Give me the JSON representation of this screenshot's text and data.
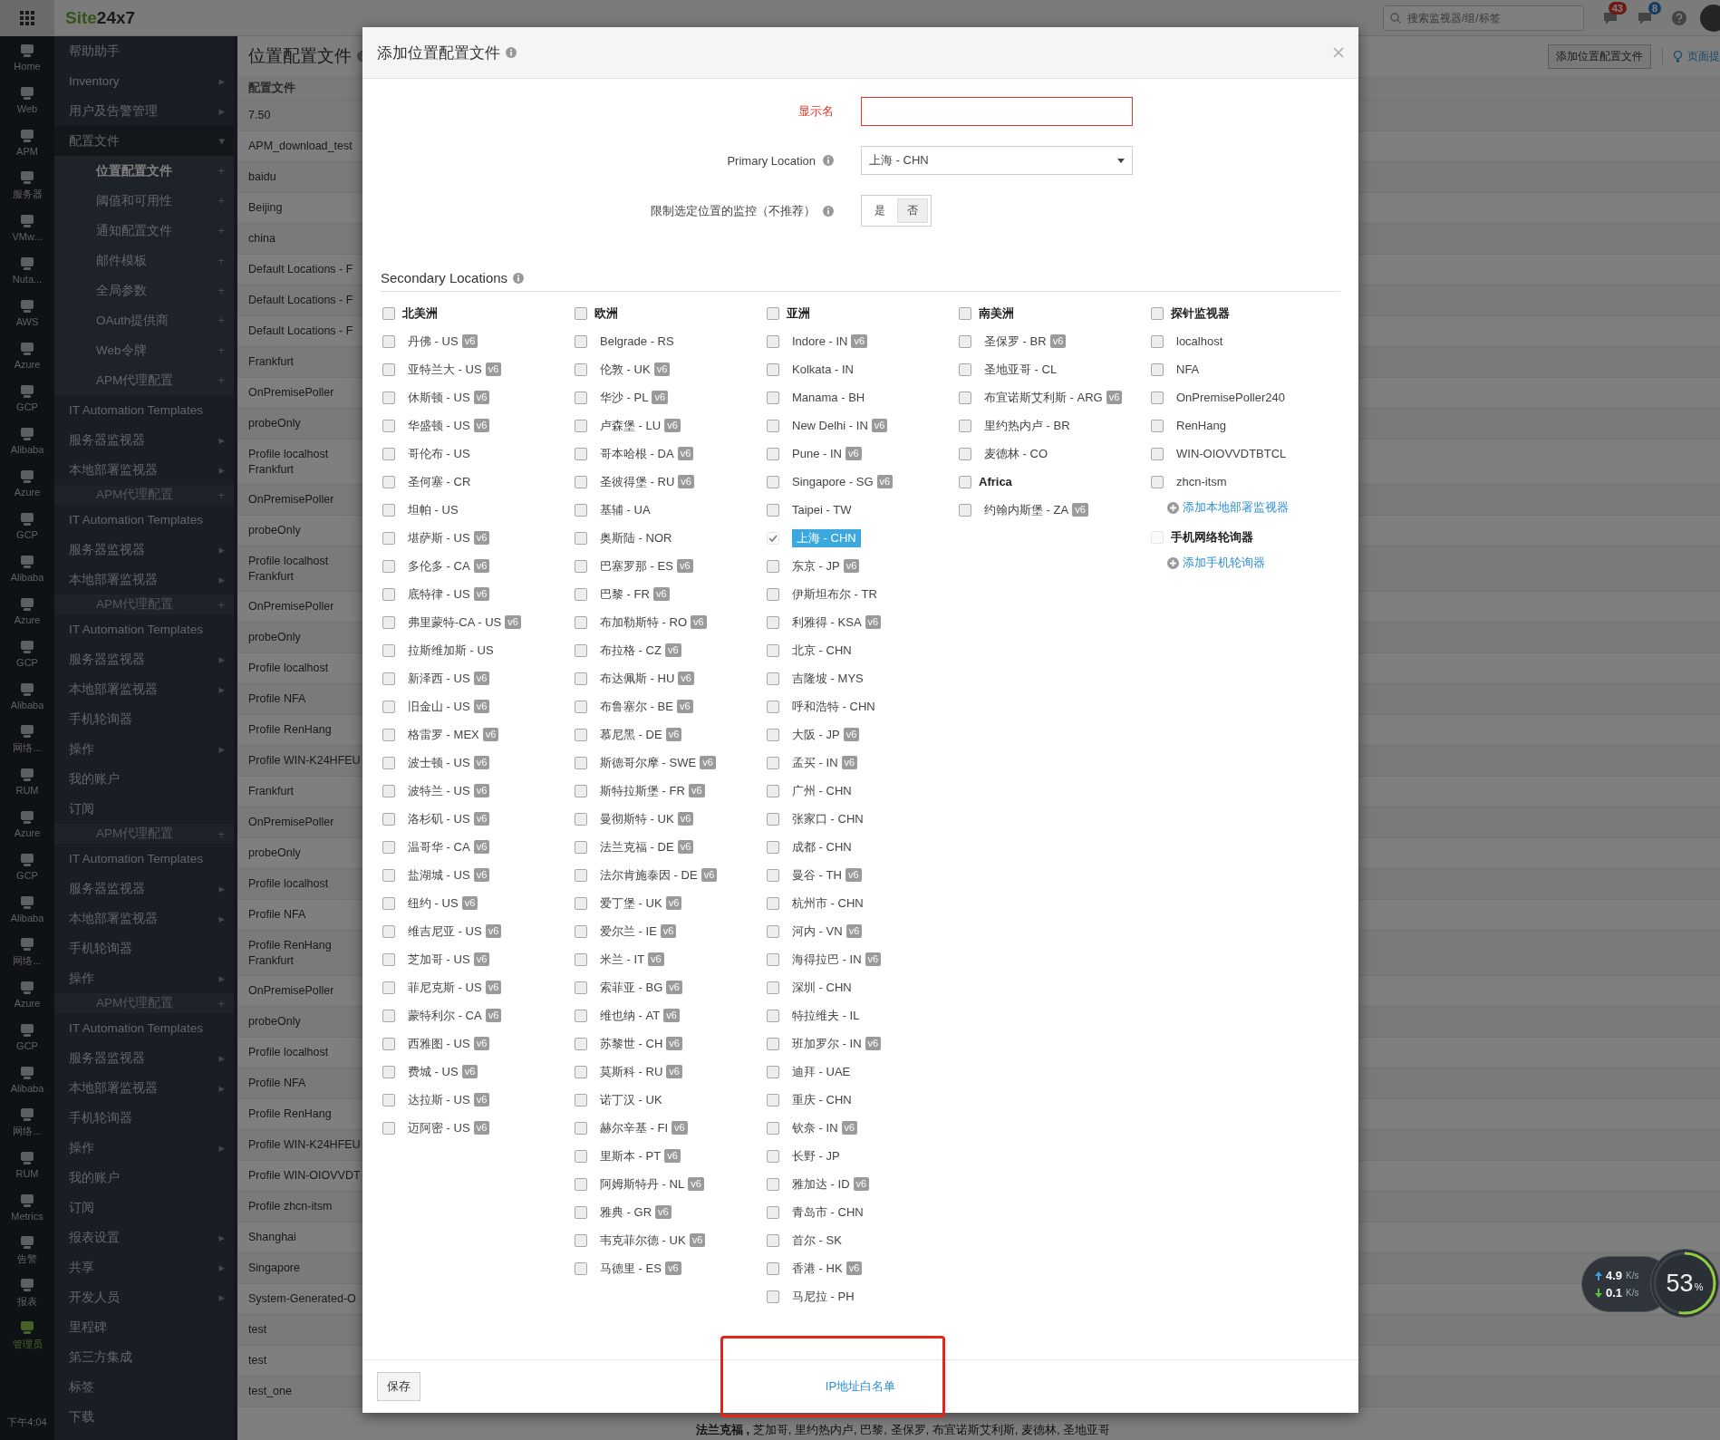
{
  "topbar": {
    "logo_site": "Site",
    "logo_suffix": "24x7",
    "search": {
      "placeholder": "搜索监视器/组/标签"
    },
    "alerts_count": "43",
    "messages_count": "8"
  },
  "rail": {
    "items": [
      {
        "label": "Home",
        "selected": false
      },
      {
        "label": "Web",
        "selected": false
      },
      {
        "label": "APM",
        "selected": false
      },
      {
        "label": "服务器",
        "selected": false
      },
      {
        "label": "VMw...",
        "selected": false
      },
      {
        "label": "Nuta...",
        "selected": false
      },
      {
        "label": "AWS",
        "selected": false
      },
      {
        "label": "Azure",
        "selected": false
      },
      {
        "label": "GCP",
        "selected": false
      },
      {
        "label": "Alibaba",
        "selected": false
      },
      {
        "label": "Azure",
        "selected": false
      },
      {
        "label": "GCP",
        "selected": false
      },
      {
        "label": "Alibaba",
        "selected": false
      },
      {
        "label": "Azure",
        "selected": false
      },
      {
        "label": "GCP",
        "selected": false
      },
      {
        "label": "Alibaba",
        "selected": false
      },
      {
        "label": "网络...",
        "selected": false
      },
      {
        "label": "RUM",
        "selected": false
      },
      {
        "label": "Azure",
        "selected": false
      },
      {
        "label": "GCP",
        "selected": false
      },
      {
        "label": "Alibaba",
        "selected": false
      },
      {
        "label": "网络...",
        "selected": false
      },
      {
        "label": "Azure",
        "selected": false
      },
      {
        "label": "GCP",
        "selected": false
      },
      {
        "label": "Alibaba",
        "selected": false
      },
      {
        "label": "网络...",
        "selected": false
      },
      {
        "label": "RUM",
        "selected": false
      },
      {
        "label": "Metrics",
        "selected": false
      },
      {
        "label": "告警",
        "selected": false
      },
      {
        "label": "报表",
        "selected": false
      },
      {
        "label": "管理员",
        "selected": true
      }
    ],
    "clock": "下午4:04"
  },
  "sidebar": {
    "items": [
      {
        "label": "帮助助手",
        "kind": "main",
        "selected": false
      },
      {
        "label": "Inventory",
        "kind": "main",
        "indicator": "▸",
        "selected": false
      },
      {
        "label": "用户及告警管理",
        "kind": "main",
        "indicator": "▸",
        "selected": false
      },
      {
        "label": "配置文件",
        "kind": "open",
        "indicator": "▾",
        "selected": false
      },
      {
        "label": "位置配置文件",
        "kind": "sub",
        "indicator": "+",
        "selected": true
      },
      {
        "label": "阈值和可用性",
        "kind": "sub",
        "indicator": "+",
        "selected": false
      },
      {
        "label": "通知配置文件",
        "kind": "sub",
        "indicator": "+",
        "selected": false
      },
      {
        "label": "邮件模板",
        "kind": "sub",
        "indicator": "+",
        "selected": false
      },
      {
        "label": "全局参数",
        "kind": "sub",
        "indicator": "+",
        "selected": false
      },
      {
        "label": "OAuth提供商",
        "kind": "sub",
        "indicator": "+",
        "selected": false
      },
      {
        "label": "Web令牌",
        "kind": "sub",
        "indicator": "+",
        "selected": false
      },
      {
        "label": "APM代理配置",
        "kind": "sub",
        "indicator": "+",
        "selected": false
      },
      {
        "label": "IT Automation Templates",
        "kind": "main",
        "selected": false
      },
      {
        "label": "服务器监视器",
        "kind": "main",
        "indicator": "▸",
        "selected": false
      },
      {
        "label": "本地部署监视器",
        "kind": "main",
        "indicator": "▸",
        "selected": false
      },
      {
        "label": "APM代理配置",
        "kind": "ghost",
        "indicator": "+",
        "selected": false
      },
      {
        "label": "IT Automation Templates",
        "kind": "main",
        "selected": false
      },
      {
        "label": "服务器监视器",
        "kind": "main",
        "indicator": "▸",
        "selected": false
      },
      {
        "label": "本地部署监视器",
        "kind": "main",
        "indicator": "▸",
        "selected": false
      },
      {
        "label": "APM代理配置",
        "kind": "ghost",
        "indicator": "+",
        "selected": false
      },
      {
        "label": "IT Automation Templates",
        "kind": "main",
        "selected": false
      },
      {
        "label": "服务器监视器",
        "kind": "main",
        "indicator": "▸",
        "selected": false
      },
      {
        "label": "本地部署监视器",
        "kind": "main",
        "indicator": "▸",
        "selected": false
      },
      {
        "label": "手机轮询器",
        "kind": "main",
        "selected": false
      },
      {
        "label": "操作",
        "kind": "main",
        "indicator": "▸",
        "selected": false
      },
      {
        "label": "我的账户",
        "kind": "main",
        "selected": false
      },
      {
        "label": "订阅",
        "kind": "main",
        "selected": false
      },
      {
        "label": "APM代理配置",
        "kind": "ghost",
        "indicator": "+",
        "selected": false
      },
      {
        "label": "IT Automation Templates",
        "kind": "main",
        "selected": false
      },
      {
        "label": "服务器监视器",
        "kind": "main",
        "indicator": "▸",
        "selected": false
      },
      {
        "label": "本地部署监视器",
        "kind": "main",
        "indicator": "▸",
        "selected": false
      },
      {
        "label": "手机轮询器",
        "kind": "main",
        "selected": false
      },
      {
        "label": "操作",
        "kind": "main",
        "indicator": "▸",
        "selected": false
      },
      {
        "label": "APM代理配置",
        "kind": "ghost",
        "indicator": "+",
        "selected": false
      },
      {
        "label": "IT Automation Templates",
        "kind": "main",
        "selected": false
      },
      {
        "label": "服务器监视器",
        "kind": "main",
        "indicator": "▸",
        "selected": false
      },
      {
        "label": "本地部署监视器",
        "kind": "main",
        "indicator": "▸",
        "selected": false
      },
      {
        "label": "手机轮询器",
        "kind": "main",
        "selected": false
      },
      {
        "label": "操作",
        "kind": "main",
        "indicator": "▸",
        "selected": false
      },
      {
        "label": "我的账户",
        "kind": "main",
        "selected": false
      },
      {
        "label": "订阅",
        "kind": "main",
        "selected": false
      },
      {
        "label": "报表设置",
        "kind": "main",
        "indicator": "▸",
        "selected": false
      },
      {
        "label": "共享",
        "kind": "main",
        "indicator": "▸",
        "selected": false
      },
      {
        "label": "开发人员",
        "kind": "main",
        "indicator": "▸",
        "selected": false
      },
      {
        "label": "里程碑",
        "kind": "main",
        "selected": false
      },
      {
        "label": "第三方集成",
        "kind": "main",
        "selected": false
      },
      {
        "label": "标签",
        "kind": "main",
        "selected": false
      },
      {
        "label": "下载",
        "kind": "main",
        "selected": false
      }
    ]
  },
  "page": {
    "title": "位置配置文件",
    "add_button": "添加位置配置文件",
    "tips_link": "页面提",
    "table": {
      "column": "配置文件",
      "rows": [
        "7.50",
        "APM_download_test",
        "baidu",
        "Beijing",
        "china",
        "Default Locations - F",
        "Default Locations - F",
        "Default Locations - F",
        "Frankfurt",
        "OnPremisePoller",
        "probeOnly",
        "Profile localhost\nFrankfurt",
        "OnPremisePoller",
        "probeOnly",
        "Profile localhost\nFrankfurt",
        "OnPremisePoller",
        "probeOnly",
        "Profile localhost",
        "Profile NFA",
        "Profile RenHang",
        "Profile WIN-K24HFEU",
        "Frankfurt",
        "OnPremisePoller",
        "probeOnly",
        "Profile localhost",
        "Profile NFA",
        "Profile RenHang\nFrankfurt",
        "OnPremisePoller",
        "probeOnly",
        "Profile localhost",
        "Profile NFA",
        "Profile RenHang",
        "Profile WIN-K24HFEU",
        "Profile WIN-OIOVVDT",
        "Profile zhcn-itsm",
        "Shanghai",
        "Singapore",
        "System-Generated-O",
        "test",
        "test",
        "test_one"
      ]
    },
    "footnote": "**法兰克福 ,** 芝加哥, 里约热内卢, 巴黎, 圣保罗, 布宜诺斯艾利斯, 麦德林, 圣地亚哥"
  },
  "modal": {
    "title": "添加位置配置文件",
    "display_name": {
      "label": "显示名",
      "invalid": true
    },
    "primary_location": {
      "label": "Primary Location",
      "value": "上海 - CHN"
    },
    "restrict": {
      "label": "限制选定位置的监控（不推荐）",
      "options": [
        {
          "label": "是",
          "selected": false
        },
        {
          "label": "否",
          "selected": true
        }
      ]
    },
    "secondary_title": "Secondary Locations",
    "columns": [
      {
        "groups": [
          {
            "title": "北美洲",
            "checked": false,
            "disabled": false,
            "items": [
              {
                "label": "丹佛 - US",
                "badge": "v6",
                "checked": false,
                "highlighted": false
              },
              {
                "label": "亚特兰大 - US",
                "badge": "v6",
                "checked": false,
                "highlighted": false
              },
              {
                "label": "休斯顿 - US",
                "badge": "v6",
                "checked": false,
                "highlighted": false
              },
              {
                "label": "华盛顿 - US",
                "badge": "v6",
                "checked": false,
                "highlighted": false
              },
              {
                "label": "哥伦布 - US",
                "checked": false,
                "highlighted": false
              },
              {
                "label": "圣何塞 - CR",
                "checked": false,
                "highlighted": false
              },
              {
                "label": "坦帕 - US",
                "checked": false,
                "highlighted": false
              },
              {
                "label": "堪萨斯 - US",
                "badge": "v6",
                "checked": false,
                "highlighted": false
              },
              {
                "label": "多伦多 - CA",
                "badge": "v6",
                "checked": false,
                "highlighted": false
              },
              {
                "label": "底特律 - US",
                "badge": "v6",
                "checked": false,
                "highlighted": false
              },
              {
                "label": "弗里蒙特-CA - US",
                "badge": "v6",
                "checked": false,
                "highlighted": false
              },
              {
                "label": "拉斯维加斯 - US",
                "checked": false,
                "highlighted": false
              },
              {
                "label": "新泽西 - US",
                "badge": "v6",
                "checked": false,
                "highlighted": false
              },
              {
                "label": "旧金山 - US",
                "badge": "v6",
                "checked": false,
                "highlighted": false
              },
              {
                "label": "格雷罗 - MEX",
                "badge": "v6",
                "checked": false,
                "highlighted": false
              },
              {
                "label": "波士顿 - US",
                "badge": "v6",
                "checked": false,
                "highlighted": false
              },
              {
                "label": "波特兰 - US",
                "badge": "v6",
                "checked": false,
                "highlighted": false
              },
              {
                "label": "洛杉矶 - US",
                "badge": "v6",
                "checked": false,
                "highlighted": false
              },
              {
                "label": "温哥华 - CA",
                "badge": "v6",
                "checked": false,
                "highlighted": false
              },
              {
                "label": "盐湖城 - US",
                "badge": "v6",
                "checked": false,
                "highlighted": false
              },
              {
                "label": "纽约 - US",
                "badge": "v6",
                "checked": false,
                "highlighted": false
              },
              {
                "label": "维吉尼亚 - US",
                "badge": "v6",
                "checked": false,
                "highlighted": false
              },
              {
                "label": "芝加哥 - US",
                "badge": "v6",
                "checked": false,
                "highlighted": false
              },
              {
                "label": "菲尼克斯 - US",
                "badge": "v6",
                "checked": false,
                "highlighted": false
              },
              {
                "label": "蒙特利尔 - CA",
                "badge": "v6",
                "checked": false,
                "highlighted": false
              },
              {
                "label": "西雅图 - US",
                "badge": "v6",
                "checked": false,
                "highlighted": false
              },
              {
                "label": "费城 - US",
                "badge": "v6",
                "checked": false,
                "highlighted": false
              },
              {
                "label": "达拉斯 - US",
                "badge": "v6",
                "checked": false,
                "highlighted": false
              },
              {
                "label": "迈阿密 - US",
                "badge": "v6",
                "checked": false,
                "highlighted": false
              }
            ]
          }
        ]
      },
      {
        "groups": [
          {
            "title": "欧洲",
            "checked": false,
            "disabled": false,
            "items": [
              {
                "label": "Belgrade - RS",
                "checked": false,
                "highlighted": false
              },
              {
                "label": "伦敦 - UK",
                "badge": "v6",
                "checked": false,
                "highlighted": false
              },
              {
                "label": "华沙 - PL",
                "badge": "v6",
                "checked": false,
                "highlighted": false
              },
              {
                "label": "卢森堡 - LU",
                "badge": "v6",
                "checked": false,
                "highlighted": false
              },
              {
                "label": "哥本哈根 - DA",
                "badge": "v6",
                "checked": false,
                "highlighted": false
              },
              {
                "label": "圣彼得堡 - RU",
                "badge": "v6",
                "checked": false,
                "highlighted": false
              },
              {
                "label": "基辅 - UA",
                "checked": false,
                "highlighted": false
              },
              {
                "label": "奥斯陆 - NOR",
                "checked": false,
                "highlighted": false
              },
              {
                "label": "巴塞罗那 - ES",
                "badge": "v6",
                "checked": false,
                "highlighted": false
              },
              {
                "label": "巴黎 - FR",
                "badge": "v6",
                "checked": false,
                "highlighted": false
              },
              {
                "label": "布加勒斯特 - RO",
                "badge": "v6",
                "checked": false,
                "highlighted": false
              },
              {
                "label": "布拉格 - CZ",
                "badge": "v6",
                "checked": false,
                "highlighted": false
              },
              {
                "label": "布达佩斯 - HU",
                "badge": "v6",
                "checked": false,
                "highlighted": false
              },
              {
                "label": "布鲁塞尔 - BE",
                "badge": "v6",
                "checked": false,
                "highlighted": false
              },
              {
                "label": "慕尼黑 - DE",
                "badge": "v6",
                "checked": false,
                "highlighted": false
              },
              {
                "label": "斯德哥尔摩 - SWE",
                "badge": "v6",
                "checked": false,
                "highlighted": false
              },
              {
                "label": "斯特拉斯堡 - FR",
                "badge": "v6",
                "checked": false,
                "highlighted": false
              },
              {
                "label": "曼彻斯特 - UK",
                "badge": "v6",
                "checked": false,
                "highlighted": false
              },
              {
                "label": "法兰克福 - DE",
                "badge": "v6",
                "checked": false,
                "highlighted": false
              },
              {
                "label": "法尔肯施泰因 - DE",
                "badge": "v6",
                "checked": false,
                "highlighted": false
              },
              {
                "label": "爱丁堡 - UK",
                "badge": "v6",
                "checked": false,
                "highlighted": false
              },
              {
                "label": "爱尔兰 - IE",
                "badge": "v6",
                "checked": false,
                "highlighted": false
              },
              {
                "label": "米兰 - IT",
                "badge": "v6",
                "checked": false,
                "highlighted": false
              },
              {
                "label": "索菲亚 - BG",
                "badge": "v6",
                "checked": false,
                "highlighted": false
              },
              {
                "label": "维也纳 - AT",
                "badge": "v6",
                "checked": false,
                "highlighted": false
              },
              {
                "label": "苏黎世 - CH",
                "badge": "v6",
                "checked": false,
                "highlighted": false
              },
              {
                "label": "莫斯科 - RU",
                "badge": "v6",
                "checked": false,
                "highlighted": false
              },
              {
                "label": "诺丁汉 - UK",
                "checked": false,
                "highlighted": false
              },
              {
                "label": "赫尔辛基 - FI",
                "badge": "v6",
                "checked": false,
                "highlighted": false
              },
              {
                "label": "里斯本 - PT",
                "badge": "v6",
                "checked": false,
                "highlighted": false
              },
              {
                "label": "阿姆斯特丹 - NL",
                "badge": "v6",
                "checked": false,
                "highlighted": false
              },
              {
                "label": "雅典 - GR",
                "badge": "v6",
                "checked": false,
                "highlighted": false
              },
              {
                "label": "韦克菲尔德 - UK",
                "badge": "v6",
                "checked": false,
                "highlighted": false
              },
              {
                "label": "马德里 - ES",
                "badge": "v6",
                "checked": false,
                "highlighted": false
              }
            ]
          }
        ]
      },
      {
        "groups": [
          {
            "title": "亚洲",
            "checked": false,
            "disabled": false,
            "items": [
              {
                "label": "Indore - IN",
                "badge": "v6",
                "checked": false,
                "highlighted": false
              },
              {
                "label": "Kolkata - IN",
                "checked": false,
                "highlighted": false
              },
              {
                "label": "Manama - BH",
                "checked": false,
                "highlighted": false
              },
              {
                "label": "New Delhi - IN",
                "badge": "v6",
                "checked": false,
                "highlighted": false
              },
              {
                "label": "Pune - IN",
                "badge": "v6",
                "checked": false,
                "highlighted": false
              },
              {
                "label": "Singapore - SG",
                "badge": "v6",
                "checked": false,
                "highlighted": false
              },
              {
                "label": "Taipei - TW",
                "checked": false,
                "highlighted": false
              },
              {
                "label": "上海 - CHN",
                "checked": true,
                "highlighted": true
              },
              {
                "label": "东京 - JP",
                "badge": "v6",
                "checked": false,
                "highlighted": false
              },
              {
                "label": "伊斯坦布尔 - TR",
                "checked": false,
                "highlighted": false
              },
              {
                "label": "利雅得 - KSA",
                "badge": "v6",
                "checked": false,
                "highlighted": false
              },
              {
                "label": "北京 - CHN",
                "checked": false,
                "highlighted": false
              },
              {
                "label": "吉隆坡 - MYS",
                "checked": false,
                "highlighted": false
              },
              {
                "label": "呼和浩特 - CHN",
                "checked": false,
                "highlighted": false
              },
              {
                "label": "大阪 - JP",
                "badge": "v6",
                "checked": false,
                "highlighted": false
              },
              {
                "label": "孟买 - IN",
                "badge": "v6",
                "checked": false,
                "highlighted": false
              },
              {
                "label": "广州 - CHN",
                "checked": false,
                "highlighted": false
              },
              {
                "label": "张家口 - CHN",
                "checked": false,
                "highlighted": false
              },
              {
                "label": "成都 - CHN",
                "checked": false,
                "highlighted": false
              },
              {
                "label": "曼谷 - TH",
                "badge": "v6",
                "checked": false,
                "highlighted": false
              },
              {
                "label": "杭州市 - CHN",
                "checked": false,
                "highlighted": false
              },
              {
                "label": "河内 - VN",
                "badge": "v6",
                "checked": false,
                "highlighted": false
              },
              {
                "label": "海得拉巴 - IN",
                "badge": "v6",
                "checked": false,
                "highlighted": false
              },
              {
                "label": "深圳 - CHN",
                "checked": false,
                "highlighted": false
              },
              {
                "label": "特拉维夫 - IL",
                "checked": false,
                "highlighted": false
              },
              {
                "label": "班加罗尔 - IN",
                "badge": "v6",
                "checked": false,
                "highlighted": false
              },
              {
                "label": "迪拜 - UAE",
                "checked": false,
                "highlighted": false
              },
              {
                "label": "重庆 - CHN",
                "checked": false,
                "highlighted": false
              },
              {
                "label": "钦奈 - IN",
                "badge": "v6",
                "checked": false,
                "highlighted": false
              },
              {
                "label": "长野 - JP",
                "checked": false,
                "highlighted": false
              },
              {
                "label": "雅加达 - ID",
                "badge": "v6",
                "checked": false,
                "highlighted": false
              },
              {
                "label": "青岛市 - CHN",
                "checked": false,
                "highlighted": false
              },
              {
                "label": "首尔 - SK",
                "checked": false,
                "highlighted": false
              },
              {
                "label": "香港 - HK",
                "badge": "v6",
                "checked": false,
                "highlighted": false
              },
              {
                "label": "马尼拉 - PH",
                "checked": false,
                "highlighted": false
              }
            ]
          }
        ]
      },
      {
        "groups": [
          {
            "title": "南美洲",
            "checked": false,
            "disabled": false,
            "items": [
              {
                "label": "圣保罗 - BR",
                "badge": "v6",
                "checked": false,
                "highlighted": false
              },
              {
                "label": "圣地亚哥 - CL",
                "checked": false,
                "highlighted": false
              },
              {
                "label": "布宜诺斯艾利斯 - ARG",
                "badge": "v6",
                "checked": false,
                "highlighted": false
              },
              {
                "label": "里约热内卢 - BR",
                "checked": false,
                "highlighted": false
              },
              {
                "label": "麦德林 - CO",
                "checked": false,
                "highlighted": false
              }
            ]
          },
          {
            "title": "Africa",
            "checked": false,
            "disabled": false,
            "items": [
              {
                "label": "约翰内斯堡 - ZA",
                "badge": "v6",
                "checked": false,
                "highlighted": false
              }
            ]
          }
        ]
      },
      {
        "groups": [
          {
            "title": "探针监视器",
            "checked": false,
            "disabled": false,
            "items": [
              {
                "label": "localhost",
                "checked": false,
                "highlighted": false
              },
              {
                "label": "NFA",
                "checked": false,
                "highlighted": false
              },
              {
                "label": "OnPremisePoller240",
                "checked": false,
                "highlighted": false
              },
              {
                "label": "RenHang",
                "checked": false,
                "highlighted": false
              },
              {
                "label": "WIN-OIOVVDTBTCL",
                "checked": false,
                "highlighted": false
              },
              {
                "label": "zhcn-itsm",
                "checked": false,
                "highlighted": false
              }
            ],
            "add_link": "添加本地部署监视器"
          },
          {
            "title": "手机网络轮询器",
            "checked": false,
            "disabled": true,
            "add_link": "添加手机轮询器"
          }
        ]
      }
    ],
    "save_button": "保存",
    "whitelist_link": "IP地址白名单"
  },
  "speed": {
    "up": "4.9",
    "up_unit": "K/s",
    "down": "0.1",
    "down_unit": "K/s",
    "percent": "53",
    "percent_sign": "%",
    "level": 0.53
  }
}
